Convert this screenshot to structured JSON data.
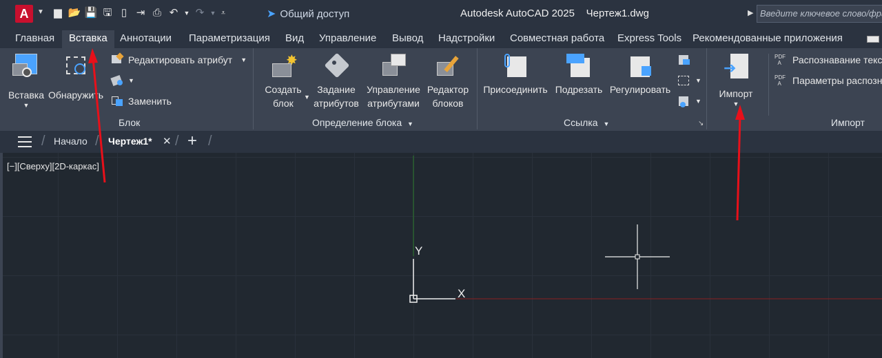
{
  "titlebar": {
    "app_letter": "A",
    "share_label": "Общий доступ",
    "app_title": "Autodesk AutoCAD 2025",
    "doc_title": "Чертеж1.dwg",
    "search_placeholder": "Введите ключевое слово/фразу"
  },
  "ribbon_tabs": [
    "Главная",
    "Вставка",
    "Аннотации",
    "Параметризация",
    "Вид",
    "Управление",
    "Вывод",
    "Надстройки",
    "Совместная работа",
    "Express Tools",
    "Рекомендованные приложения"
  ],
  "active_tab": "Вставка",
  "panels": {
    "block": {
      "title": "Блок",
      "insert_label": "Вставка",
      "detect_label": "Обнаружить",
      "edit_attr_label": "Редактировать атрибут",
      "replace_label": "Заменить"
    },
    "block_def": {
      "title": "Определение блока",
      "create_l1": "Создать",
      "create_l2": "блок",
      "attrdef_l1": "Задание",
      "attrdef_l2": "атрибутов",
      "attrmgr_l1": "Управление",
      "attrmgr_l2": "атрибутами",
      "editor_l1": "Редактор",
      "editor_l2": "блоков"
    },
    "reference": {
      "title": "Ссылка",
      "attach_label": "Присоединить",
      "clip_label": "Подрезать",
      "adjust_label": "Регулировать"
    },
    "import": {
      "title": "Импорт",
      "import_label": "Импорт",
      "pdf_recog_label": "Распознавание текста",
      "pdf_params_label": "Параметры распознавания"
    }
  },
  "doc_tabs": {
    "start": "Начало",
    "drawing": "Чертеж1*"
  },
  "viewport": {
    "label": "[−][Сверху][2D-каркас]",
    "y_axis": "Y",
    "x_axis": "X"
  },
  "colors": {
    "accent_red": "#e8101a",
    "share_blue": "#4aa3ff",
    "app_red": "#c8102e"
  }
}
